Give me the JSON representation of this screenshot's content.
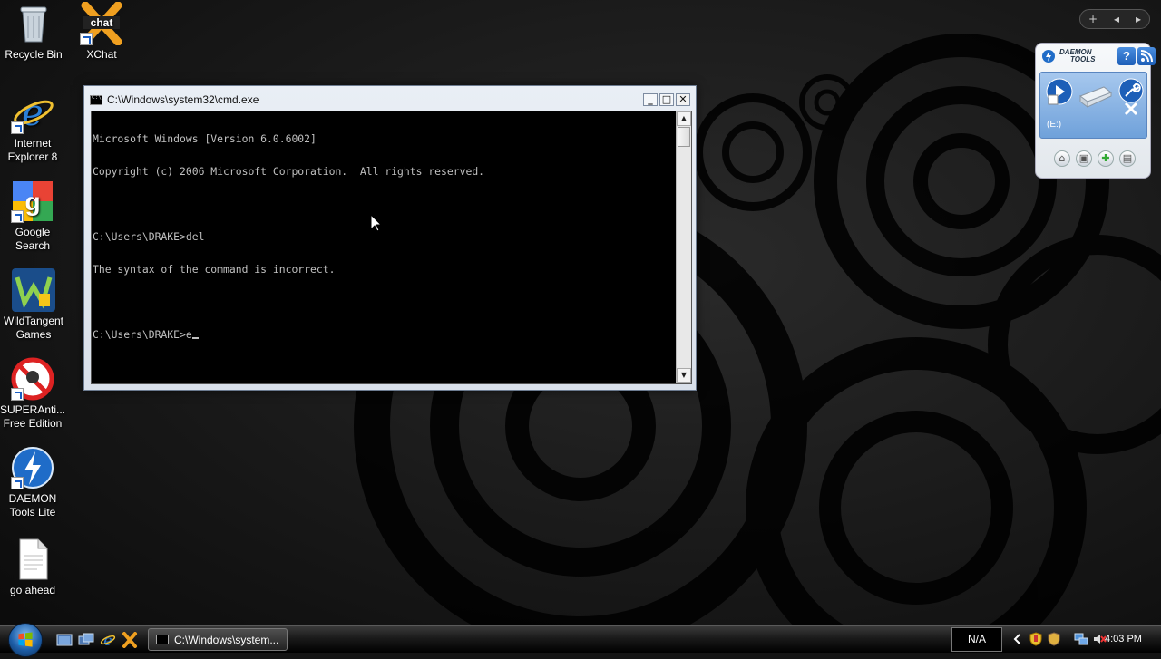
{
  "desktop": {
    "icons": [
      {
        "label": "Recycle Bin",
        "icon": "recycle-bin-icon"
      },
      {
        "label": "XChat",
        "icon": "xchat-icon"
      },
      {
        "label": "Internet Explorer 8",
        "icon": "internet-explorer-icon"
      },
      {
        "label": "Google Search",
        "icon": "google-search-icon"
      },
      {
        "label": "WildTangent Games",
        "icon": "wildtangent-icon"
      },
      {
        "label": "SUPERAnti... Free Edition",
        "icon": "superantispyware-icon"
      },
      {
        "label": "DAEMON Tools Lite",
        "icon": "daemon-tools-icon"
      },
      {
        "label": "go ahead",
        "icon": "text-document-icon"
      }
    ]
  },
  "cmd_window": {
    "title": "C:\\Windows\\system32\\cmd.exe",
    "lines": [
      "Microsoft Windows [Version 6.0.6002]",
      "Copyright (c) 2006 Microsoft Corporation.  All rights reserved.",
      "",
      "C:\\Users\\DRAKE>del",
      "The syntax of the command is incorrect.",
      "",
      "C:\\Users\\DRAKE>e"
    ],
    "buttons": {
      "minimize": "_",
      "maximize": "□",
      "close": "✕"
    }
  },
  "daemon_gadget": {
    "brand_line1": "DAEMON",
    "brand_line2": "TOOLS",
    "help": "?",
    "drive_label": "(E:)"
  },
  "taskbar": {
    "task_button_label": "C:\\Windows\\system...",
    "language": "N/A",
    "clock": "4:03 PM"
  },
  "colors": {
    "desktop_background": "#141414",
    "console_text": "#c0c0c0",
    "console_background": "#000000",
    "daemon_accent": "#6fa1da"
  }
}
